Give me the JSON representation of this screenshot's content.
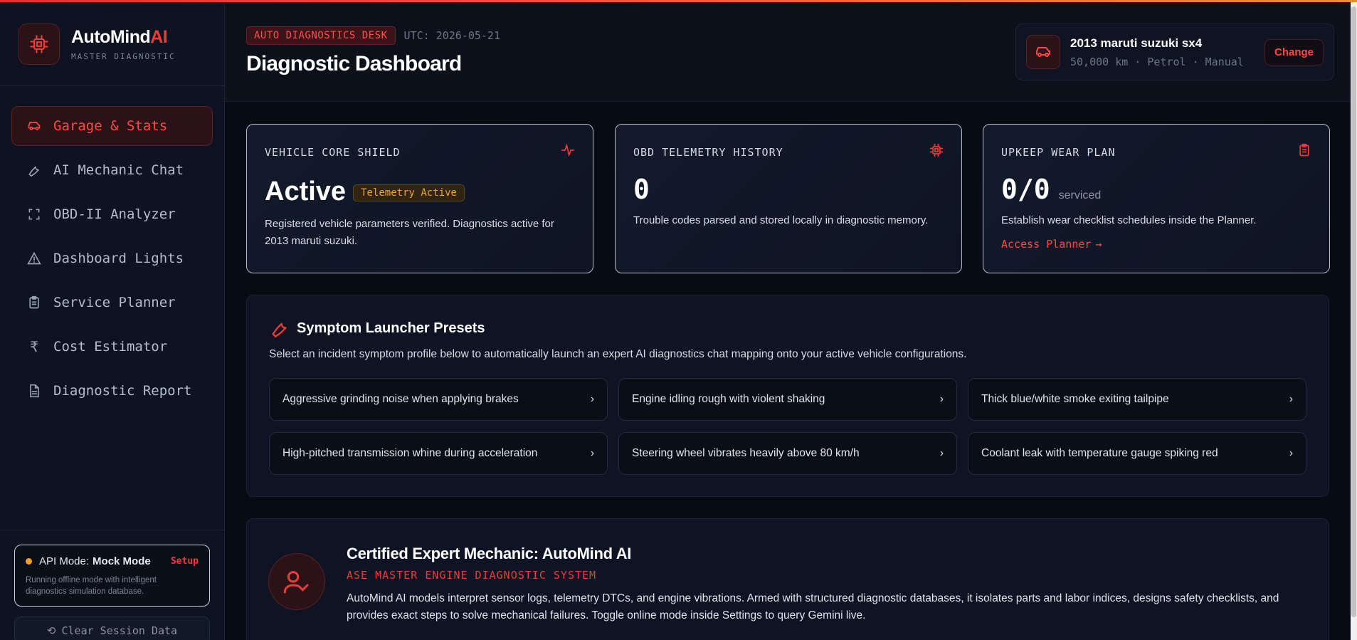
{
  "brand": {
    "name": "AutoMind",
    "name_accent": "AI",
    "subtitle": "MASTER DIAGNOSTIC"
  },
  "nav": {
    "items": [
      {
        "label": "Garage & Stats",
        "icon": "car-icon",
        "active": true
      },
      {
        "label": "AI Mechanic Chat",
        "icon": "wrench-icon",
        "active": false
      },
      {
        "label": "OBD-II Analyzer",
        "icon": "scan-icon",
        "active": false
      },
      {
        "label": "Dashboard Lights",
        "icon": "warning-icon",
        "active": false
      },
      {
        "label": "Service Planner",
        "icon": "clipboard-icon",
        "active": false
      },
      {
        "label": "Cost Estimator",
        "icon": "rupee-icon",
        "active": false
      },
      {
        "label": "Diagnostic Report",
        "icon": "document-icon",
        "active": false
      }
    ]
  },
  "api": {
    "prefix": "API Mode:",
    "mode": "Mock Mode",
    "setup_label": "Setup",
    "description": "Running offline mode with intelligent diagnostics simulation database.",
    "status_color": "#f0a12c"
  },
  "clear_session_label": "Clear Session Data",
  "header": {
    "badge": "AUTO DIAGNOSTICS DESK",
    "utc": "UTC: 2026-05-21",
    "title": "Diagnostic Dashboard"
  },
  "vehicle": {
    "name": "2013 maruti suzuki sx4",
    "meta": "50,000 km · Petrol · Manual",
    "change_label": "Change"
  },
  "stats": {
    "shield": {
      "title": "VEHICLE CORE SHIELD",
      "value": "Active",
      "badge": "Telemetry Active",
      "description": "Registered vehicle parameters verified. Diagnostics active for 2013 maruti suzuki."
    },
    "obd": {
      "title": "OBD TELEMETRY HISTORY",
      "value": "0",
      "description": "Trouble codes parsed and stored locally in diagnostic memory."
    },
    "upkeep": {
      "title": "UPKEEP WEAR PLAN",
      "value": "0/0",
      "unit": "serviced",
      "description": "Establish wear checklist schedules inside the Planner.",
      "link": "Access Planner"
    }
  },
  "symptoms": {
    "title": "Symptom Launcher Presets",
    "description": "Select an incident symptom profile below to automatically launch an expert AI diagnostics chat mapping onto your active vehicle configurations.",
    "presets": [
      "Aggressive grinding noise when applying brakes",
      "Engine idling rough with violent shaking",
      "Thick blue/white smoke exiting tailpipe",
      "High-pitched transmission whine during acceleration",
      "Steering wheel vibrates heavily above 80 km/h",
      "Coolant leak with temperature gauge spiking red"
    ]
  },
  "mechanic": {
    "title": "Certified Expert Mechanic: AutoMind AI",
    "subtitle": "ASE MASTER ENGINE DIAGNOSTIC SYSTEM",
    "description": "AutoMind AI models interpret sensor logs, telemetry DTCs, and engine vibrations. Armed with structured diagnostic databases, it isolates parts and labor indices, designs safety checklists, and provides exact steps to solve mechanical failures. Toggle online mode inside Settings to query Gemini live."
  },
  "colors": {
    "accent": "#ef3b36",
    "warning": "#f0a12c",
    "background": "#070b14"
  }
}
